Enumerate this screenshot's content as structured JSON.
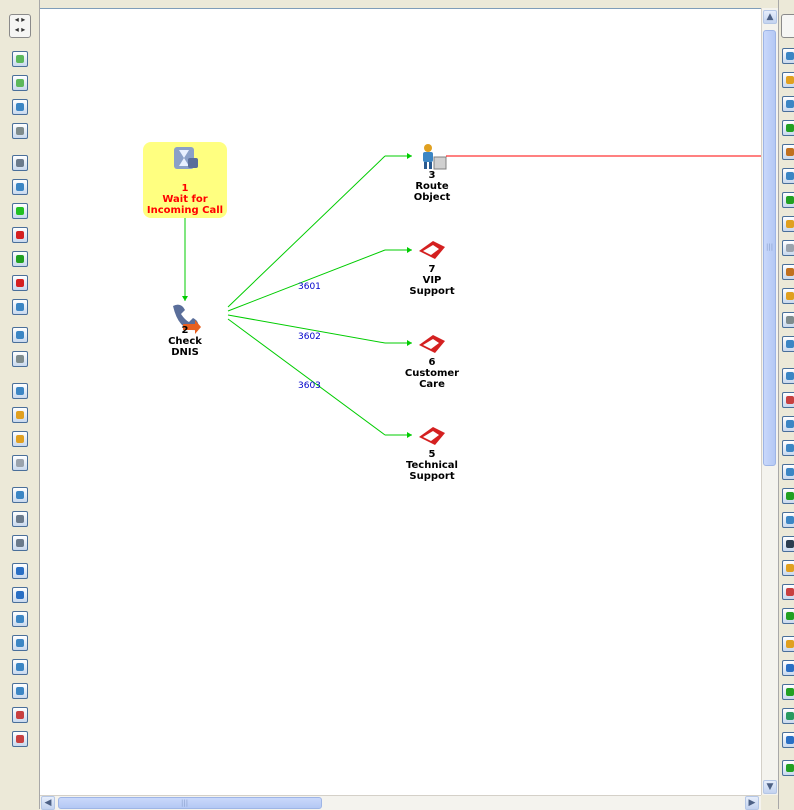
{
  "window": {
    "left_toolbar": {
      "collapse_icon": "collapse-arrows-icon",
      "buttons": [
        {
          "icon": "new-page-icon",
          "color": "#5cb85c"
        },
        {
          "icon": "copy-page-icon",
          "color": "#5cb85c"
        },
        {
          "icon": "delete-page-icon",
          "color": "#3c86c4"
        },
        {
          "icon": "settings-icon",
          "color": "#7f8c8d"
        },
        {
          "icon": "phone-icon",
          "color": "#6b7b8c"
        },
        {
          "icon": "person-transfer-icon",
          "color": "#3c86c4"
        },
        {
          "icon": "green-dot-icon",
          "color": "#22c022"
        },
        {
          "icon": "route-red-icon",
          "color": "#d42020"
        },
        {
          "icon": "green-route-icon",
          "color": "#22a022"
        },
        {
          "icon": "red-ball-icon",
          "color": "#d42020"
        },
        {
          "icon": "document-icon",
          "color": "#3c86c4"
        },
        {
          "icon": "globe-icon",
          "color": "#3c86c4"
        },
        {
          "icon": "gray-gear-icon",
          "color": "#7f8c8d"
        },
        {
          "icon": "wait-icon",
          "color": "#3c86c4"
        },
        {
          "icon": "envelope-icon",
          "color": "#e0a020"
        },
        {
          "icon": "mail-check-icon",
          "color": "#e0a020"
        },
        {
          "icon": "gray-block-icon",
          "color": "#9aa3ad"
        },
        {
          "icon": "filter-icon",
          "color": "#3c86c4"
        },
        {
          "icon": "funnel-down-icon",
          "color": "#6b7b8c"
        },
        {
          "icon": "funnel-icon",
          "color": "#6b7b8c"
        },
        {
          "icon": "blue-globe-icon",
          "color": "#2a6fc4"
        },
        {
          "icon": "table-icon",
          "color": "#2a6fc4"
        },
        {
          "icon": "database-icon",
          "color": "#3c86c4"
        },
        {
          "icon": "database-arrow-icon",
          "color": "#3c86c4"
        },
        {
          "icon": "database-edit-icon",
          "color": "#3c86c4"
        },
        {
          "icon": "database-list-icon",
          "color": "#3c86c4"
        },
        {
          "icon": "database-red-icon",
          "color": "#c84040"
        },
        {
          "icon": "database-delete-icon",
          "color": "#c84040"
        }
      ]
    },
    "right_toolbar": {
      "buttons": [
        {
          "icon": "tools-icon",
          "color": "#3c86c4"
        },
        {
          "icon": "agent-icon",
          "color": "#e0a020"
        },
        {
          "icon": "link-icon",
          "color": "#3c86c4"
        },
        {
          "icon": "transfer-icon",
          "color": "#22a022"
        },
        {
          "icon": "stats-icon",
          "color": "#c07020"
        },
        {
          "icon": "link-edit-icon",
          "color": "#3c86c4"
        },
        {
          "icon": "play-icon",
          "color": "#22a022"
        },
        {
          "icon": "target-icon",
          "color": "#e0a020"
        },
        {
          "icon": "page-icon",
          "color": "#9aa3ad"
        },
        {
          "icon": "stamp-icon",
          "color": "#c07020"
        },
        {
          "icon": "user-yellow-icon",
          "color": "#e0a020"
        },
        {
          "icon": "eraser-icon",
          "color": "#7f8c8d"
        },
        {
          "icon": "gear-icon",
          "color": "#3c86c4"
        },
        {
          "icon": "people-icon",
          "color": "#3c86c4"
        },
        {
          "icon": "agent-red-icon",
          "color": "#c84040"
        },
        {
          "icon": "music-icon",
          "color": "#3c86c4"
        },
        {
          "icon": "agent-group-icon",
          "color": "#3c86c4"
        },
        {
          "icon": "agents-icon",
          "color": "#3c86c4"
        },
        {
          "icon": "green-person-icon",
          "color": "#22a022"
        },
        {
          "icon": "graduate-icon",
          "color": "#3c86c4"
        },
        {
          "icon": "graduate-dark-icon",
          "color": "#2c3e50"
        },
        {
          "icon": "person-yellow-icon",
          "color": "#e0a020"
        },
        {
          "icon": "person-red-icon",
          "color": "#c84040"
        },
        {
          "icon": "tree-icon",
          "color": "#22a022"
        },
        {
          "icon": "speaker-icon",
          "color": "#e0a020"
        },
        {
          "icon": "globe-nav-icon",
          "color": "#2a6fc4"
        },
        {
          "icon": "chart-icon",
          "color": "#22a022"
        },
        {
          "icon": "globe-green-icon",
          "color": "#2a9a60"
        },
        {
          "icon": "globe-blue-icon",
          "color": "#2a6fc4"
        },
        {
          "icon": "play-step-icon",
          "color": "#22a022"
        }
      ]
    },
    "flow": {
      "nodes": [
        {
          "id": "1",
          "name_line1": "Wait for",
          "name_line2": "Incoming Call",
          "icon": "hourglass-phone-icon"
        },
        {
          "id": "2",
          "name_line1": "Check",
          "name_line2": "DNIS",
          "icon": "phone-route-icon"
        },
        {
          "id": "3",
          "name_line1": "Route",
          "name_line2": "Object",
          "icon": "agent-route-icon"
        },
        {
          "id": "7",
          "name_line1": "VIP",
          "name_line2": "Support",
          "icon": "route-red-icon"
        },
        {
          "id": "6",
          "name_line1": "Customer",
          "name_line2": "Care",
          "icon": "route-red-icon"
        },
        {
          "id": "5",
          "name_line1": "Technical",
          "name_line2": "Support",
          "icon": "route-red-icon"
        }
      ],
      "link_labels": {
        "vip": "3601",
        "care": "3602",
        "tech": "3603"
      },
      "colors": {
        "link": "#00cc00",
        "red_link": "#ff0000",
        "label": "#0000cc",
        "start_fill": "#ffff80",
        "start_text": "#ff0000"
      }
    },
    "scrollbars": {
      "up": "▲",
      "down": "▼",
      "left": "◀",
      "right": "▶",
      "grip": "|||"
    }
  }
}
